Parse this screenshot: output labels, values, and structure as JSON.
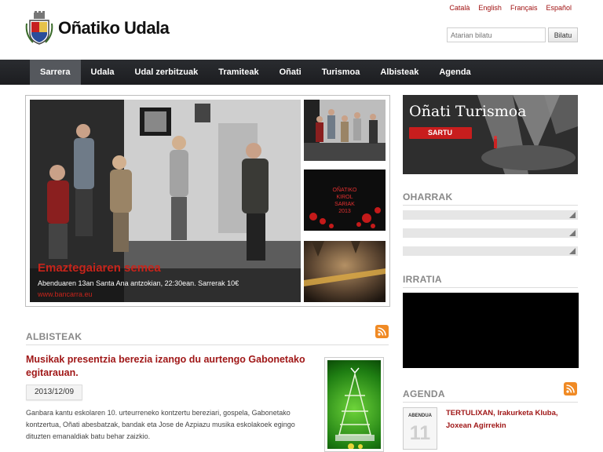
{
  "languages": [
    "Català",
    "English",
    "Français",
    "Español"
  ],
  "site": {
    "title": "Oñatiko Udala"
  },
  "search": {
    "placeholder": "Atarian bilatu",
    "button": "Bilatu"
  },
  "nav": {
    "items": [
      "Sarrera",
      "Udala",
      "Udal zerbitzuak",
      "Tramiteak",
      "Oñati",
      "Turismoa",
      "Albisteak",
      "Agenda"
    ],
    "active": "Sarrera"
  },
  "slider": {
    "caption_title": "Emaztegaiaren semea",
    "caption_text": "Abenduaren 13an Santa Ana antzokian, 22:30ean. Sarrerak 10€",
    "caption_link": "www.bancarra.eu",
    "thumb2_text": [
      "OÑATIKO",
      "KIROL",
      "SARIAK",
      "2013"
    ]
  },
  "albisteak": {
    "heading": "ALBISTEAK",
    "news_title": "Musikak presentzia berezia izango du aurtengo Gabonetako egitarauan.",
    "news_date": "2013/12/09",
    "news_body": "Ganbara kantu eskolaren 10. urteurreneko kontzertu bereziari, gospela, Gabonetako kontzertua, Oñati abesbatzak, bandak eta Jose de Azpiazu musika eskolakoek egingo dituzten emanaldiak batu behar zaizkio."
  },
  "turismo": {
    "title": "Oñati Turismoa",
    "button": "SARTU"
  },
  "oharrak": {
    "heading": "OHARRAK"
  },
  "irratia": {
    "heading": "IRRATIA"
  },
  "agenda": {
    "heading": "AGENDA",
    "month": "ABENDUA",
    "day": "11",
    "event": "TERTULIXAN, Irakurketa Kluba, Joxean Agirrekin"
  },
  "colors": {
    "accent_red": "#a01818",
    "nav_bg": "#1f2023",
    "nav_active": "#55585d"
  }
}
